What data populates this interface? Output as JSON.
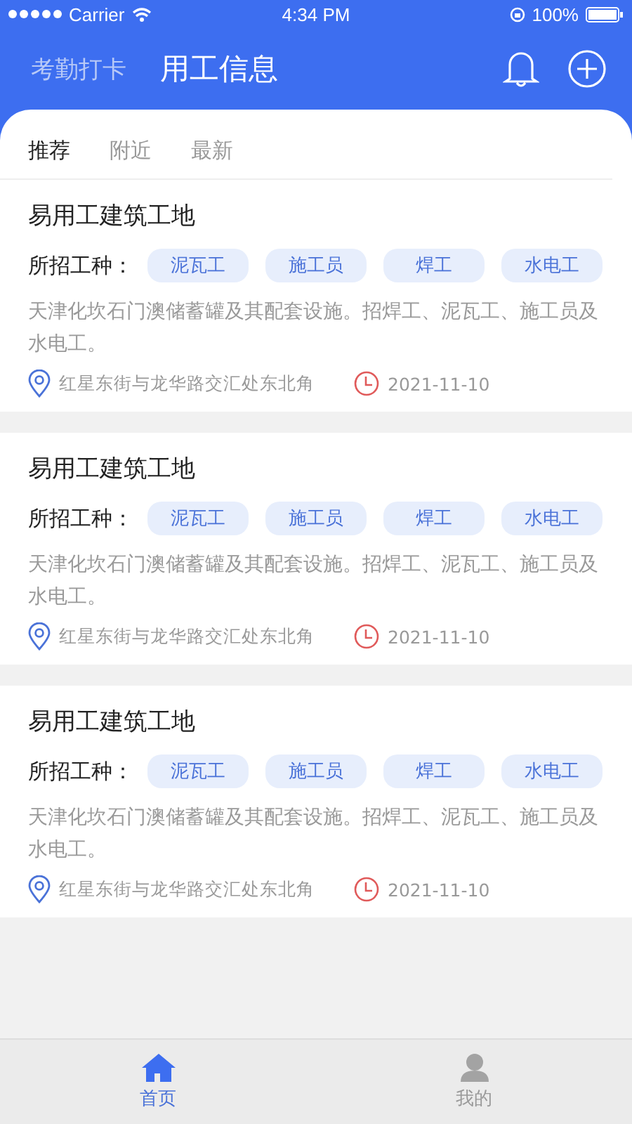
{
  "status_bar": {
    "carrier": "Carrier",
    "time": "4:34 PM",
    "battery": "100%"
  },
  "header": {
    "secondary_title": "考勤打卡",
    "title": "用工信息"
  },
  "tabs": [
    {
      "label": "推荐",
      "selected": true
    },
    {
      "label": "附近",
      "selected": false
    },
    {
      "label": "最新",
      "selected": false
    }
  ],
  "jobs": [
    {
      "title": "易用工建筑工地",
      "trades_label": "所招工种：",
      "trades": [
        "泥瓦工",
        "施工员",
        "焊工",
        "水电工"
      ],
      "description": "天津化坎石门澳储蓄罐及其配套设施。招焊工、泥瓦工、施工员及水电工。",
      "address": "红星东街与龙华路交汇处东北角",
      "date": "2021-11-10"
    },
    {
      "title": "易用工建筑工地",
      "trades_label": "所招工种：",
      "trades": [
        "泥瓦工",
        "施工员",
        "焊工",
        "水电工"
      ],
      "description": "天津化坎石门澳储蓄罐及其配套设施。招焊工、泥瓦工、施工员及水电工。",
      "address": "红星东街与龙华路交汇处东北角",
      "date": "2021-11-10"
    },
    {
      "title": "易用工建筑工地",
      "trades_label": "所招工种：",
      "trades": [
        "泥瓦工",
        "施工员",
        "焊工",
        "水电工"
      ],
      "description": "天津化坎石门澳储蓄罐及其配套设施。招焊工、泥瓦工、施工员及水电工。",
      "address": "红星东街与龙华路交汇处东北角",
      "date": "2021-11-10"
    }
  ],
  "bottom_nav": [
    {
      "label": "首页",
      "kind": "home",
      "selected": true
    },
    {
      "label": "我的",
      "kind": "profile",
      "selected": false
    }
  ]
}
